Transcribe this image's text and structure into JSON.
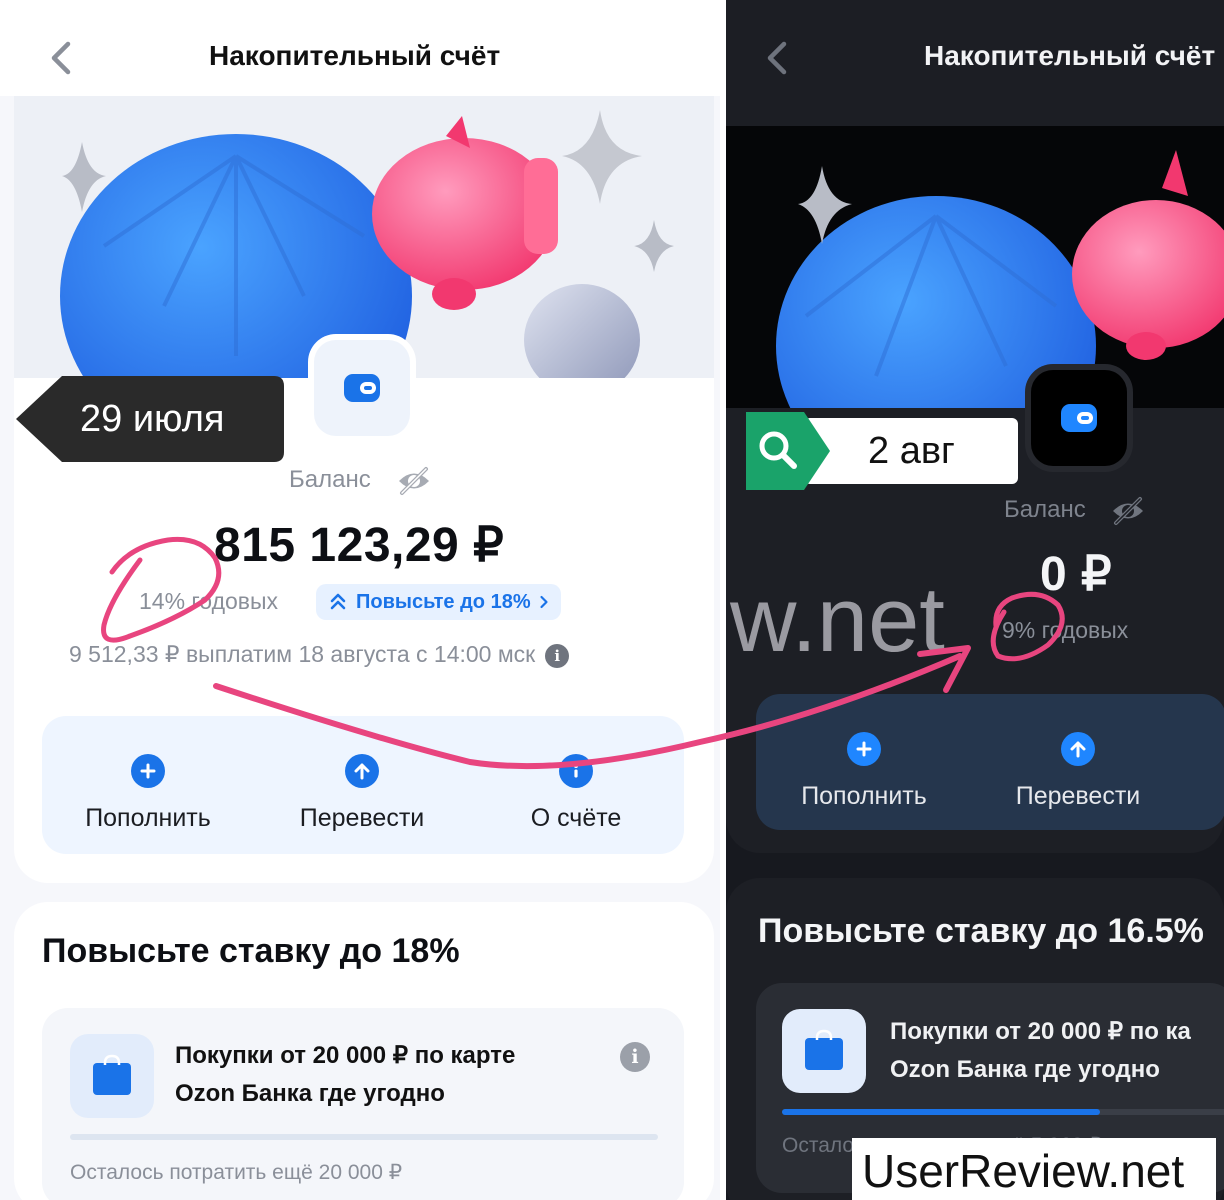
{
  "left": {
    "title": "Накопительный счёт",
    "date_tag": "29 июля",
    "balance_label": "Баланс",
    "balance": "815 123,29 ₽",
    "rate": "14% годовых",
    "boost_chip": "Повысьте до 18%",
    "payout": "9 512,33 ₽ выплатим 18 августа с 14:00 мск",
    "actions": [
      "Пополнить",
      "Перевести",
      "О счёте"
    ],
    "promo_title": "Повысьте ставку до 18%",
    "task_line1": "Покупки от 20 000 ₽ по карте",
    "task_line2": "Ozon Банка где угодно",
    "task_progress": 0,
    "remaining": "Осталось потратить ещё 20 000 ₽"
  },
  "right": {
    "title": "Накопительный счёт",
    "date_tag": "2 авг",
    "balance_label": "Баланс",
    "balance": "0 ₽",
    "rate": "9% годовых",
    "actions": [
      "Пополнить",
      "Перевести"
    ],
    "promo_title": "Повысьте ставку до 16.5%",
    "task_line1": "Покупки от 20 000 ₽ по ка",
    "task_line2": "Ozon Банка где угодно",
    "task_progress": 0.7,
    "remaining": "Осталось потратить ещё 5 963 ₽"
  },
  "watermark_mid": "w.net",
  "watermark": "UserReview.net",
  "colors": {
    "accent": "#1a73e8",
    "annotation": "#e8457f",
    "dark_bg": "#17191f",
    "search_tag": "#1aa36a"
  }
}
